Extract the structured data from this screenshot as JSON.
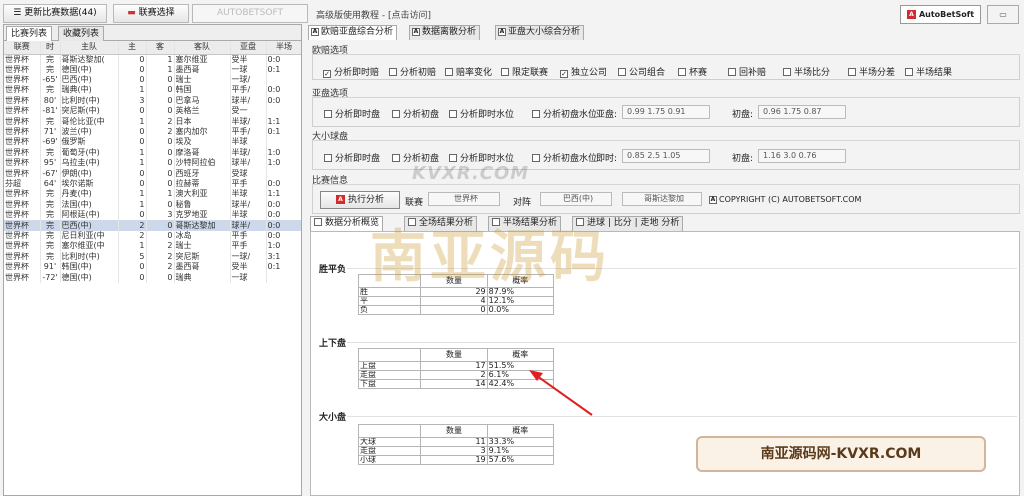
{
  "toolbar": {
    "update_label": "更新比赛数据(44)",
    "league_select_label": "联赛选择",
    "autobetsoft_label": "AUTOBETSOFT",
    "help_text": "高级版使用教程 - [点击访问]",
    "logo_text": "AutoBetSoft",
    "mini_icon": "restore-icon"
  },
  "left": {
    "tabs": [
      "比赛列表",
      "收藏列表"
    ],
    "columns": [
      "联赛",
      "时",
      "主队",
      "主",
      "客",
      "客队",
      "亚盘",
      "半场"
    ],
    "rows": [
      [
        "世界杯",
        "完",
        "哥斯达黎加(",
        "0",
        "1",
        "塞尔维亚",
        "受半",
        "0:0"
      ],
      [
        "世界杯",
        "完",
        "德国(中)",
        "0",
        "1",
        "墨西哥",
        "一球",
        "0:1"
      ],
      [
        "世界杯",
        "-65'",
        "巴西(中)",
        "0",
        "0",
        "瑞士",
        "一球/",
        ""
      ],
      [
        "世界杯",
        "完",
        "瑞典(中)",
        "1",
        "0",
        "韩国",
        "平手/",
        "0:0"
      ],
      [
        "世界杯",
        "80'",
        "比利时(中)",
        "3",
        "0",
        "巴拿马",
        "球半/",
        "0:0"
      ],
      [
        "世界杯",
        "-81'",
        "突尼斯(中)",
        "0",
        "0",
        "英格兰",
        "受一",
        ""
      ],
      [
        "世界杯",
        "完",
        "哥伦比亚(中",
        "1",
        "2",
        "日本",
        "半球/",
        "1:1"
      ],
      [
        "世界杯",
        "71'",
        "波兰(中)",
        "0",
        "2",
        "塞内加尔",
        "平手/",
        "0:1"
      ],
      [
        "世界杯",
        "-69'",
        "俄罗斯",
        "0",
        "0",
        "埃及",
        "半球",
        ""
      ],
      [
        "世界杯",
        "完",
        "葡萄牙(中)",
        "1",
        "0",
        "摩洛哥",
        "半球/",
        "1:0"
      ],
      [
        "世界杯",
        "95'",
        "乌拉圭(中)",
        "1",
        "0",
        "沙特阿拉伯",
        "球半/",
        "1:0"
      ],
      [
        "世界杯",
        "-67'",
        "伊朗(中)",
        "0",
        "0",
        "西班牙",
        "受球",
        ""
      ],
      [
        "芬超",
        "64'",
        "埃尔诺斯",
        "0",
        "0",
        "拉赫蒂",
        "平手",
        "0:0"
      ],
      [
        "世界杯",
        "完",
        "丹麦(中)",
        "1",
        "1",
        "澳大利亚",
        "半球",
        "1:1"
      ],
      [
        "世界杯",
        "完",
        "法国(中)",
        "1",
        "0",
        "秘鲁",
        "球半/",
        "0:0"
      ],
      [
        "世界杯",
        "完",
        "阿根廷(中)",
        "0",
        "3",
        "克罗地亚",
        "半球",
        "0:0"
      ],
      [
        "世界杯",
        "完",
        "巴西(中)",
        "2",
        "0",
        "哥斯达黎加",
        "球半/",
        "0:0"
      ],
      [
        "世界杯",
        "完",
        "尼日利亚(中",
        "2",
        "0",
        "冰岛",
        "平手",
        "0:0"
      ],
      [
        "世界杯",
        "完",
        "塞尔维亚(中",
        "1",
        "2",
        "瑞士",
        "平手",
        "1:0"
      ],
      [
        "世界杯",
        "完",
        "比利时(中)",
        "5",
        "2",
        "突尼斯",
        "一球/",
        "3:1"
      ],
      [
        "世界杯",
        "91'",
        "韩国(中)",
        "0",
        "2",
        "墨西哥",
        "受半",
        "0:1"
      ],
      [
        "世界杯",
        "-72'",
        "德国(中)",
        "0",
        "0",
        "瑞典",
        "一球",
        ""
      ]
    ],
    "selected_row": 16
  },
  "right": {
    "tabs": [
      "欧赔亚盘综合分析",
      "数据离散分析",
      "亚盘大小综合分析"
    ],
    "tab_icon": "A",
    "odds": {
      "title": "欧赔选项",
      "checks": [
        {
          "label": "分析即时赔",
          "checked": true
        },
        {
          "label": "分析初赔",
          "checked": false
        },
        {
          "label": "赔率变化",
          "checked": false
        },
        {
          "label": "限定联赛",
          "checked": false
        },
        {
          "label": "独立公司",
          "checked": true
        },
        {
          "label": "公司组合",
          "checked": false
        },
        {
          "label": "杯赛",
          "checked": false
        },
        {
          "label": "回补赔",
          "checked": false
        },
        {
          "label": "半场比分",
          "checked": false
        },
        {
          "label": "半场分差",
          "checked": false
        },
        {
          "label": "半场结果",
          "checked": false
        }
      ]
    },
    "asian": {
      "title": "亚盘选项",
      "checks": [
        "分析即时盘",
        "分析初盘",
        "分析即时水位",
        "分析初盘水位"
      ],
      "current_label": "亚盘:",
      "current_value": "0.99 1.75 0.91",
      "initial_label": "初盘:",
      "initial_value": "0.96 1.75 0.87"
    },
    "ou": {
      "title": "大小球盘",
      "checks": [
        "分析即时盘",
        "分析初盘",
        "分析即时水位",
        "分析初盘水位"
      ],
      "current_label": "即时:",
      "current_value": "0.85 2.5 1.05",
      "initial_label": "初盘:",
      "initial_value": "1.16 3.0 0.76"
    },
    "match": {
      "title": "比赛信息",
      "run_label": "执行分析",
      "run_icon": "A",
      "league_label": "联赛",
      "league_value": "世界杯",
      "teams_label": "对阵",
      "home": "巴西(中)",
      "away": "哥斯达黎加",
      "copyright": "COPYRIGHT (C) AUTOBETSOFT.COM"
    },
    "bottom_tabs": [
      "数据分析概览",
      "全场结果分析",
      "半场结果分析",
      "进球 | 比分 | 走地 分析"
    ],
    "groups": [
      {
        "title": "胜平负",
        "headers": [
          "",
          "数量",
          "概率"
        ],
        "rows": [
          [
            "胜",
            "29",
            "87.9%"
          ],
          [
            "平",
            "4",
            "12.1%"
          ],
          [
            "负",
            "0",
            "0.0%"
          ]
        ]
      },
      {
        "title": "上下盘",
        "headers": [
          "",
          "数量",
          "概率"
        ],
        "rows": [
          [
            "上盘",
            "17",
            "51.5%"
          ],
          [
            "走盘",
            "2",
            "6.1%"
          ],
          [
            "下盘",
            "14",
            "42.4%"
          ]
        ]
      },
      {
        "title": "大小盘",
        "headers": [
          "",
          "数量",
          "概率"
        ],
        "rows": [
          [
            "大球",
            "11",
            "33.3%"
          ],
          [
            "走盘",
            "3",
            "9.1%"
          ],
          [
            "小球",
            "19",
            "57.6%"
          ]
        ]
      }
    ]
  },
  "watermarks": [
    "KVXR.COM",
    "南亚源码",
    "南亚源码网-KVXR.COM"
  ],
  "colors": {
    "selected_row": "#cdd8ea",
    "accent_red": "#d62b2b",
    "arrow": "#e02020"
  }
}
